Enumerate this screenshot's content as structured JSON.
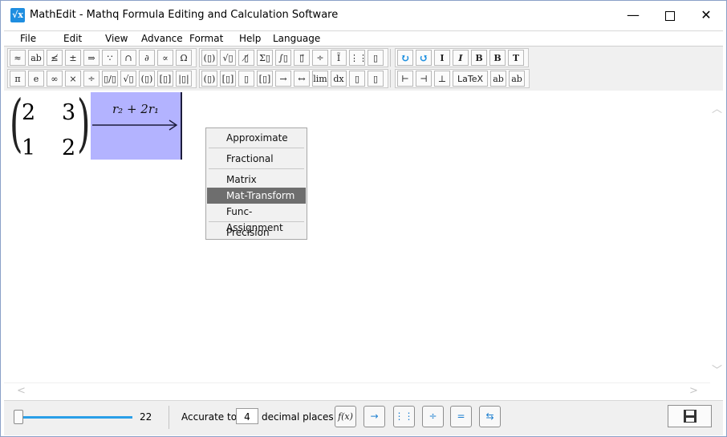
{
  "window": {
    "app_icon": "√x",
    "title": "MathEdit - Mathq Formula Editing and Calculation Software",
    "minimize": "—",
    "close": "✕"
  },
  "menu": [
    "File",
    "Edit",
    "View",
    "Advance",
    "Format",
    "Help",
    "Language"
  ],
  "toolbar": {
    "row1": [
      "≈",
      "ab",
      "≰",
      "±",
      "⇒",
      "∵",
      "∩",
      "∂",
      "∝",
      "Ω",
      "(▯)",
      "√▯",
      "▯̸",
      "Σ▯",
      "∫▯",
      "▯⃗",
      "÷",
      "Ĩ",
      "⋮⋮",
      "▯"
    ],
    "row1_format": [
      "↻",
      "↺",
      "I",
      "I",
      "B",
      "B",
      "T"
    ],
    "row2": [
      "π",
      "e",
      "∞",
      "×",
      "÷",
      "▯/▯",
      "√▯",
      "(▯)",
      "[▯]",
      "|▯|",
      "(▯)",
      "[▯]",
      "▯",
      "[▯]",
      "→",
      "↔",
      "lim",
      "dx",
      "▯",
      "▯"
    ],
    "row2_format": [
      "⊢",
      "⊣",
      "⊥",
      "LaTeX",
      "ab",
      "ab"
    ]
  },
  "editor": {
    "matrix": [
      [
        "2",
        "3"
      ],
      [
        "1",
        "2"
      ]
    ],
    "transform_label": "r₂ + 2r₁",
    "transform_color": "#b3b3ff"
  },
  "context_menu": {
    "items": [
      "Approximate",
      "Fractional",
      "Matrix",
      "Mat-Transform",
      "Func-Assignment",
      "Precision"
    ],
    "selected": "Mat-Transform",
    "selected_color": "#6e6e6e"
  },
  "statusbar": {
    "zoom_value": "22",
    "accurate_label": "Accurate to",
    "decimal_places": "4",
    "decimal_suffix": "decimal places",
    "buttons": [
      "f(x)",
      "→",
      "⋮⋮",
      "÷",
      "=",
      "⇆"
    ],
    "save_icon": "save-icon",
    "accent_color": "#2a9fe8"
  }
}
